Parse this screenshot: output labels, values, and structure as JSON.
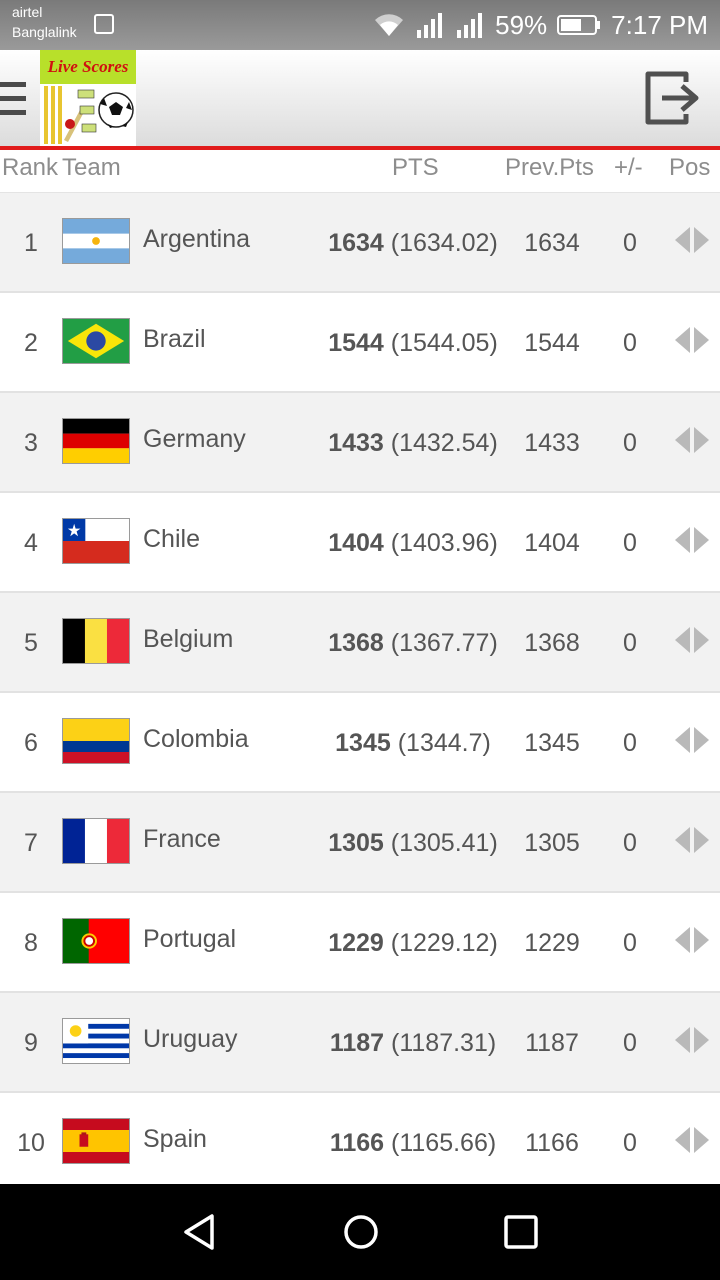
{
  "status_bar": {
    "carrier_1": "airtel",
    "carrier_2": "Banglalink",
    "battery": "59%",
    "time": "7:17 PM",
    "icons": [
      "photo-icon",
      "wifi-icon",
      "signal-icon",
      "signal-icon",
      "battery-icon"
    ]
  },
  "app_bar": {
    "logo_text": "Live Scores",
    "menu_icon": "hamburger-icon",
    "exit_icon": "exit-icon"
  },
  "table": {
    "headers": {
      "rank": "Rank",
      "team": "Team",
      "pts": "PTS",
      "prev": "Prev.Pts",
      "diff": "+/-",
      "pos": "Pos"
    },
    "rows": [
      {
        "rank": "1",
        "team": "Argentina",
        "pts": "1634",
        "pts_exact": "(1634.02)",
        "prev": "1634",
        "diff": "0",
        "flag": "argentina"
      },
      {
        "rank": "2",
        "team": "Brazil",
        "pts": "1544",
        "pts_exact": "(1544.05)",
        "prev": "1544",
        "diff": "0",
        "flag": "brazil"
      },
      {
        "rank": "3",
        "team": "Germany",
        "pts": "1433",
        "pts_exact": "(1432.54)",
        "prev": "1433",
        "diff": "0",
        "flag": "germany"
      },
      {
        "rank": "4",
        "team": "Chile",
        "pts": "1404",
        "pts_exact": "(1403.96)",
        "prev": "1404",
        "diff": "0",
        "flag": "chile"
      },
      {
        "rank": "5",
        "team": "Belgium",
        "pts": "1368",
        "pts_exact": "(1367.77)",
        "prev": "1368",
        "diff": "0",
        "flag": "belgium"
      },
      {
        "rank": "6",
        "team": "Colombia",
        "pts": "1345",
        "pts_exact": "(1344.7)",
        "prev": "1345",
        "diff": "0",
        "flag": "colombia"
      },
      {
        "rank": "7",
        "team": "France",
        "pts": "1305",
        "pts_exact": "(1305.41)",
        "prev": "1305",
        "diff": "0",
        "flag": "france"
      },
      {
        "rank": "8",
        "team": "Portugal",
        "pts": "1229",
        "pts_exact": "(1229.12)",
        "prev": "1229",
        "diff": "0",
        "flag": "portugal"
      },
      {
        "rank": "9",
        "team": "Uruguay",
        "pts": "1187",
        "pts_exact": "(1187.31)",
        "prev": "1187",
        "diff": "0",
        "flag": "uruguay"
      },
      {
        "rank": "10",
        "team": "Spain",
        "pts": "1166",
        "pts_exact": "(1165.66)",
        "prev": "1166",
        "diff": "0",
        "flag": "spain"
      }
    ]
  },
  "colors": {
    "accent_red": "#e11b1b",
    "logo_green": "#b8e02a",
    "row_alt": "#f2f2f2",
    "text": "#555555"
  },
  "nav_bar": {
    "buttons": [
      "back-icon",
      "home-icon",
      "recents-icon"
    ]
  }
}
